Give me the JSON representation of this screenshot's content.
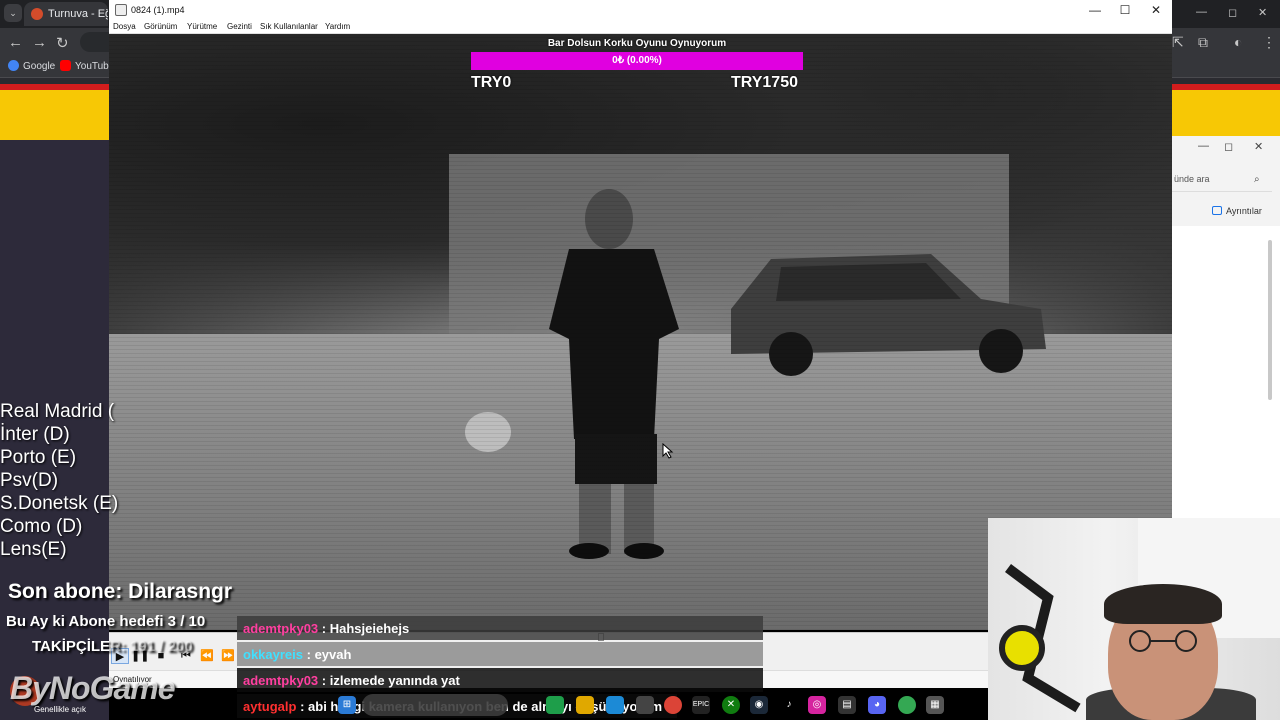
{
  "browser": {
    "tab_title": "Turnuva - Eğlence",
    "bookmarks": [
      {
        "label": "Google",
        "icon": "google-icon"
      },
      {
        "label": "YouTube",
        "icon": "youtube-icon"
      }
    ]
  },
  "explorer": {
    "search_placeholder": "ünde ara",
    "details_label": "Ayrıntılar"
  },
  "player": {
    "window_title": "0824 (1).mp4",
    "menu": [
      "Dosya",
      "Görünüm",
      "Yürütme",
      "Gezinti",
      "Sık Kullanılanlar",
      "Yardım"
    ],
    "status_text": "Oynatılıyor",
    "progress_fraction": 0.46,
    "state": "playing"
  },
  "donation_goal": {
    "title": "Bar Dolsun Korku Oyunu Oynuyorum",
    "progress_text": "0₺ (0.00%)",
    "min_label": "TRY0",
    "max_label": "TRY1750",
    "progress_fraction": 0.0,
    "bar_color": "#e000e0"
  },
  "stream_overlay": {
    "leagues": [
      "Real Madrid (",
      "İnter (D)",
      "Porto (E)",
      "Psv(D)",
      "S.Donetsk (E)",
      "Como (D)",
      "Lens(E)"
    ],
    "last_subscriber": "Son abone: Dilarasngr",
    "subscriber_goal": "Bu Ay ki Abone hedefi 3 / 10",
    "followers_label": "TAKİPÇİLE",
    "followers_count": "R: 191 / 200",
    "brand_name": "ByNoGame",
    "brand_sub": "Genellikle açık"
  },
  "chat": [
    {
      "user": "ademtpky03",
      "message": "Hahsjeiehejs",
      "user_color": "#ff3fa0",
      "bg": "rgba(60,60,60,0.85)"
    },
    {
      "user": "okkayreis",
      "message": "eyvah",
      "user_color": "#3fe0ff",
      "bg": "rgba(140,140,140,0.85)"
    },
    {
      "user": "ademtpky03",
      "message": "izlemede yanında yat",
      "user_color": "#ff3fa0",
      "bg": "rgba(10,10,10,0.85)"
    },
    {
      "user": "aytugalp",
      "message": "abi hangi kamera kullanıyon ben de almayı düşünüyorum",
      "user_color": "#ff3030",
      "bg": "rgba(10,10,10,0.85)"
    }
  ],
  "colors": {
    "site_banner": "#f7c805",
    "site_banner_stripe": "#d21d1d",
    "goal_bar": "#e000e0"
  }
}
